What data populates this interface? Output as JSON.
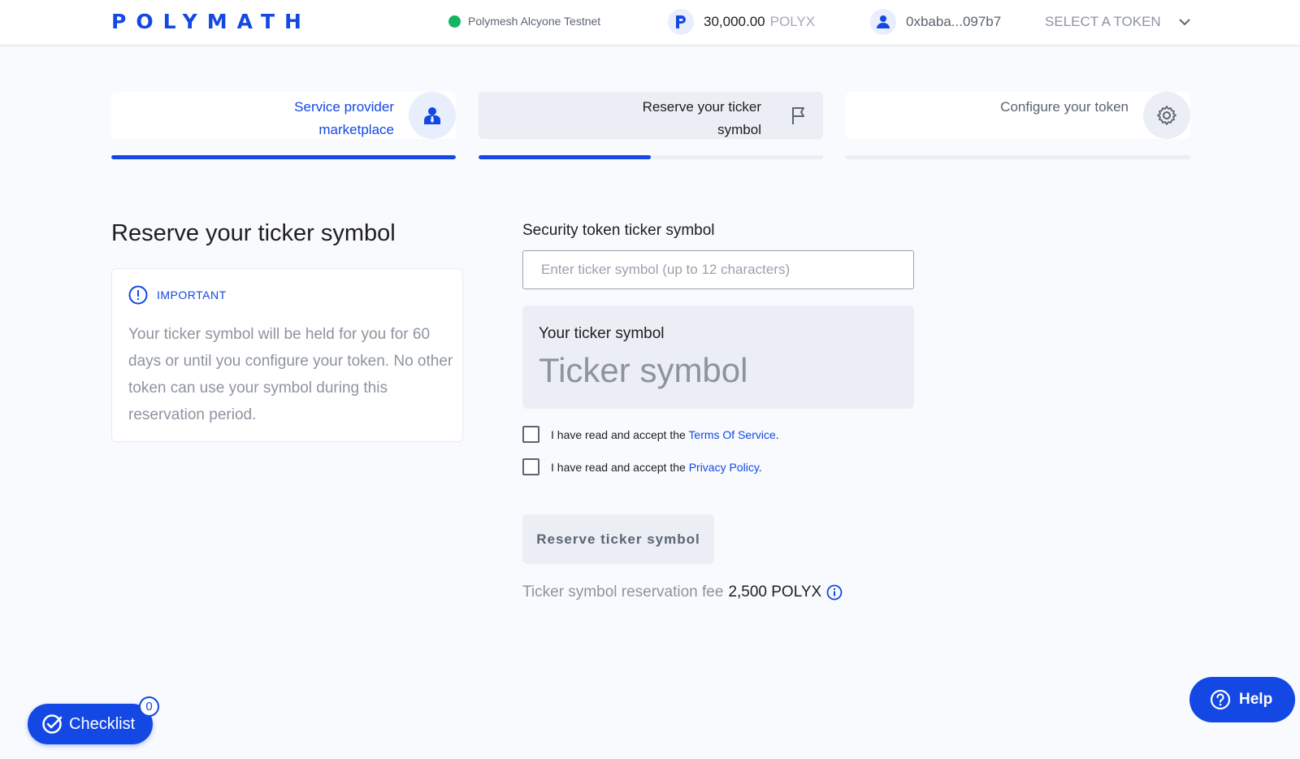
{
  "header": {
    "logo": "POLYMATH",
    "network": "Polymesh Alcyone Testnet",
    "balance_amount": "30,000.00",
    "balance_unit": "POLYX",
    "account": "0xbaba...097b7",
    "token_select": "SELECT A TOKEN"
  },
  "steps": [
    {
      "label": "Service provider marketplace",
      "icon": "provider-icon",
      "progress": 1.0
    },
    {
      "label": "Reserve your ticker symbol",
      "icon": "flag-icon",
      "progress": 0.5
    },
    {
      "label": "Configure your token",
      "icon": "gear-icon",
      "progress": 0.0
    }
  ],
  "main": {
    "title": "Reserve your ticker symbol",
    "notice": {
      "heading": "IMPORTANT",
      "text": "Your ticker symbol will be held for you for 60 days or until you configure your token. No other token can use your symbol during this reservation period."
    },
    "form": {
      "field_label": "Security token ticker symbol",
      "input_placeholder": "Enter ticker symbol (up to 12 characters)",
      "input_value": "",
      "preview_label": "Your ticker symbol",
      "preview_value": "Ticker symbol",
      "terms_prefix": "I have read and accept the ",
      "terms_link": "Terms Of Service",
      "privacy_prefix": "I have read and accept the ",
      "privacy_link": "Privacy Policy",
      "period": ".",
      "reserve_button": "Reserve ticker symbol",
      "fee_label": "Ticker symbol reservation fee",
      "fee_amount": "2,500 POLYX"
    }
  },
  "floating": {
    "checklist_label": "Checklist",
    "checklist_count": "0",
    "help_label": "Help"
  },
  "colors": {
    "accent": "#1348e4",
    "network_status": "#12b564",
    "muted_text": "#8d949f"
  }
}
